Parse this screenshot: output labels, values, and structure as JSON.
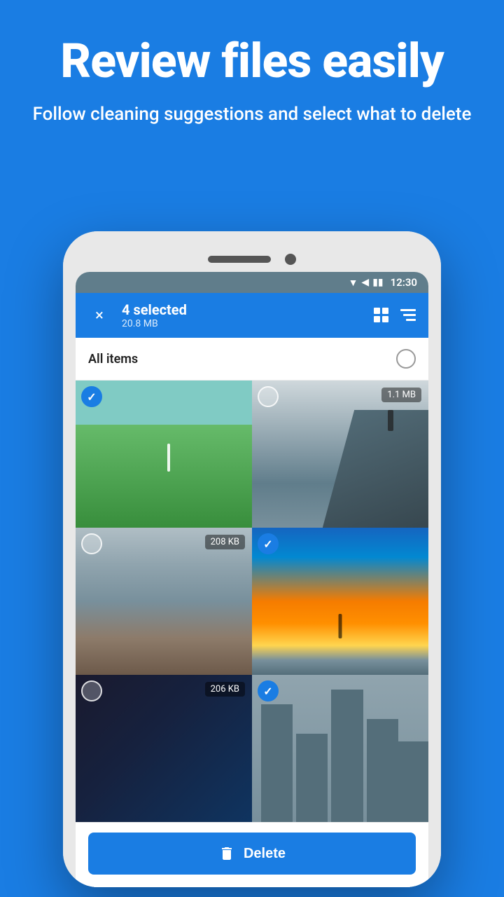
{
  "hero": {
    "title": "Review files easily",
    "subtitle": "Follow cleaning suggestions and select what to delete"
  },
  "status_bar": {
    "time": "12:30",
    "wifi": "▼",
    "signal": "▲",
    "battery": "▪"
  },
  "toolbar": {
    "selected_count": "4 selected",
    "size": "20.8 MB",
    "close_label": "×",
    "grid_icon": "⊞",
    "sort_icon": "≡"
  },
  "all_items": {
    "label": "All items"
  },
  "photos": [
    {
      "id": 1,
      "checked": true,
      "size": null,
      "scene": "green"
    },
    {
      "id": 2,
      "checked": false,
      "size": "1.1 MB",
      "scene": "cliff"
    },
    {
      "id": 3,
      "checked": false,
      "size": "208 KB",
      "scene": "mountain"
    },
    {
      "id": 4,
      "checked": true,
      "size": null,
      "scene": "sunset"
    },
    {
      "id": 5,
      "checked": false,
      "size": "206 KB",
      "scene": "dark"
    },
    {
      "id": 6,
      "checked": true,
      "size": null,
      "scene": "building"
    }
  ],
  "delete_btn": {
    "label": "Delete"
  },
  "colors": {
    "primary": "#1a7de3",
    "toolbar_bg": "#1a7de3",
    "status_bar": "#607d8b"
  }
}
